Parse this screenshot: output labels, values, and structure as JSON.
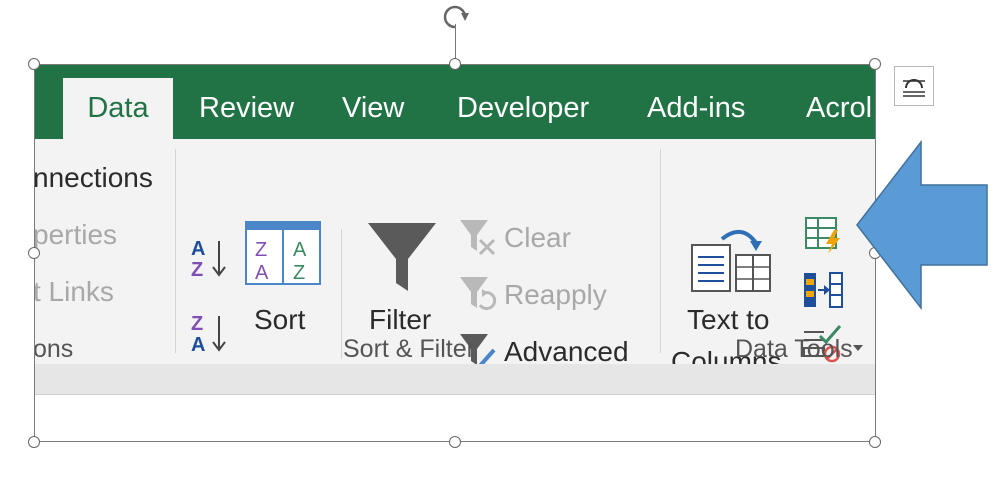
{
  "tabs": [
    "Data",
    "Review",
    "View",
    "Developer",
    "Add-ins",
    "Acrol"
  ],
  "connections_group": {
    "items": [
      "nnections",
      "perties",
      "t Links"
    ],
    "group_label": "ons"
  },
  "sort_filter": {
    "sort_label": "Sort",
    "filter_label": "Filter",
    "clear_label": "Clear",
    "reapply_label": "Reapply",
    "advanced_label": "Advanced",
    "group_label": "Sort & Filter"
  },
  "data_tools": {
    "text_to_columns_line1": "Text to",
    "text_to_columns_line2": "Columns",
    "group_label": "Data Tools"
  },
  "colors": {
    "tab_bar": "#217346",
    "ribbon": "#f3f3f3",
    "arrow": "#5b9bd5",
    "sort_purple": "#7f4fb5",
    "sort_green": "#3a8a63",
    "icon_blue": "#1f4e9a",
    "icon_orange": "#f0a400"
  },
  "icons": [
    "sort-az-icon",
    "sort-za-icon",
    "sort-dialog-icon",
    "filter-funnel-icon",
    "clear-filter-icon",
    "reapply-filter-icon",
    "advanced-filter-icon",
    "text-to-columns-icon",
    "flash-fill-icon",
    "remove-duplicates-icon",
    "data-validation-icon",
    "layout-options-icon",
    "rotate-handle-icon",
    "blue-arrow-callout"
  ]
}
